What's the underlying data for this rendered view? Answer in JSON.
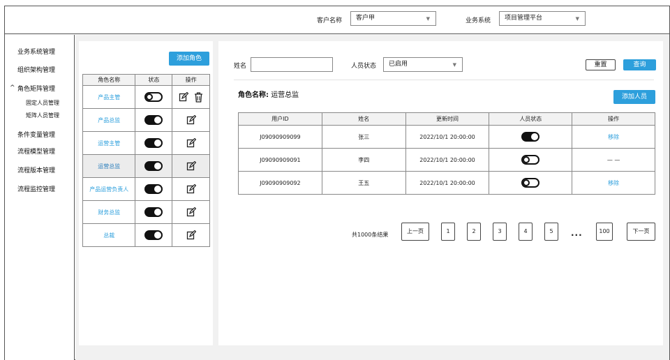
{
  "header": {
    "customer_label": "客户名称",
    "customer_value": "客户甲",
    "system_label": "业务系统",
    "system_value": "项目管理平台"
  },
  "sidebar": {
    "items": [
      {
        "label": "业务系统管理"
      },
      {
        "label": "组织架构管理"
      },
      {
        "label": "角色矩阵管理",
        "expanded": true,
        "caret": "^"
      },
      {
        "label": "条件变量管理"
      },
      {
        "label": "流程模型管理"
      },
      {
        "label": "流程版本管理"
      },
      {
        "label": "流程监控管理"
      }
    ],
    "sub_items": [
      {
        "label": "固定人员管理"
      },
      {
        "label": "矩阵人员管理"
      }
    ]
  },
  "roles_panel": {
    "add_role_label": "添加角色",
    "columns": [
      "角色名称",
      "状态",
      "操作"
    ],
    "rows": [
      {
        "name": "产品主管",
        "enabled": false,
        "deletable": true
      },
      {
        "name": "产品总监",
        "enabled": true,
        "deletable": false
      },
      {
        "name": "运营主管",
        "enabled": true,
        "deletable": false
      },
      {
        "name": "运营总监",
        "enabled": true,
        "deletable": false,
        "active": true
      },
      {
        "name": "产品运营负责人",
        "enabled": true,
        "deletable": false
      },
      {
        "name": "财务总监",
        "enabled": true,
        "deletable": false
      },
      {
        "name": "总裁",
        "enabled": true,
        "deletable": false
      }
    ]
  },
  "filters": {
    "name_label": "姓名",
    "name_value": "",
    "status_label": "人员状态",
    "status_value": "已启用",
    "reset_label": "重置",
    "query_label": "查询"
  },
  "role_header": {
    "prefix": "角色名称:",
    "name": "运营总监",
    "add_person_label": "添加人员"
  },
  "users_table": {
    "columns": [
      "用户ID",
      "姓名",
      "更新时间",
      "人员状态",
      "操作"
    ],
    "rows": [
      {
        "id": "J09090909099",
        "name": "张三",
        "time": "2022/10/1  20:00:00",
        "enabled": true,
        "action": "移除"
      },
      {
        "id": "J09090909091",
        "name": "李四",
        "time": "2022/10/1  20:00:00",
        "enabled": false,
        "action": "— —"
      },
      {
        "id": "J09090909092",
        "name": "王五",
        "time": "2022/10/1  20:00:00",
        "enabled": false,
        "action": "移除"
      }
    ]
  },
  "pagination": {
    "total_text": "共1000条结果",
    "prev_label": "上一页",
    "next_label": "下一页",
    "pages": [
      "1",
      "2",
      "3",
      "4",
      "5"
    ],
    "ellipsis": "...",
    "last_page": "100"
  },
  "colors": {
    "accent": "#2d9fdc",
    "border": "#888888",
    "background": "#f1f1f1"
  },
  "icons": {
    "edit": "edit-icon",
    "delete": "trash-icon",
    "dropdown": "chevron-down-icon"
  }
}
